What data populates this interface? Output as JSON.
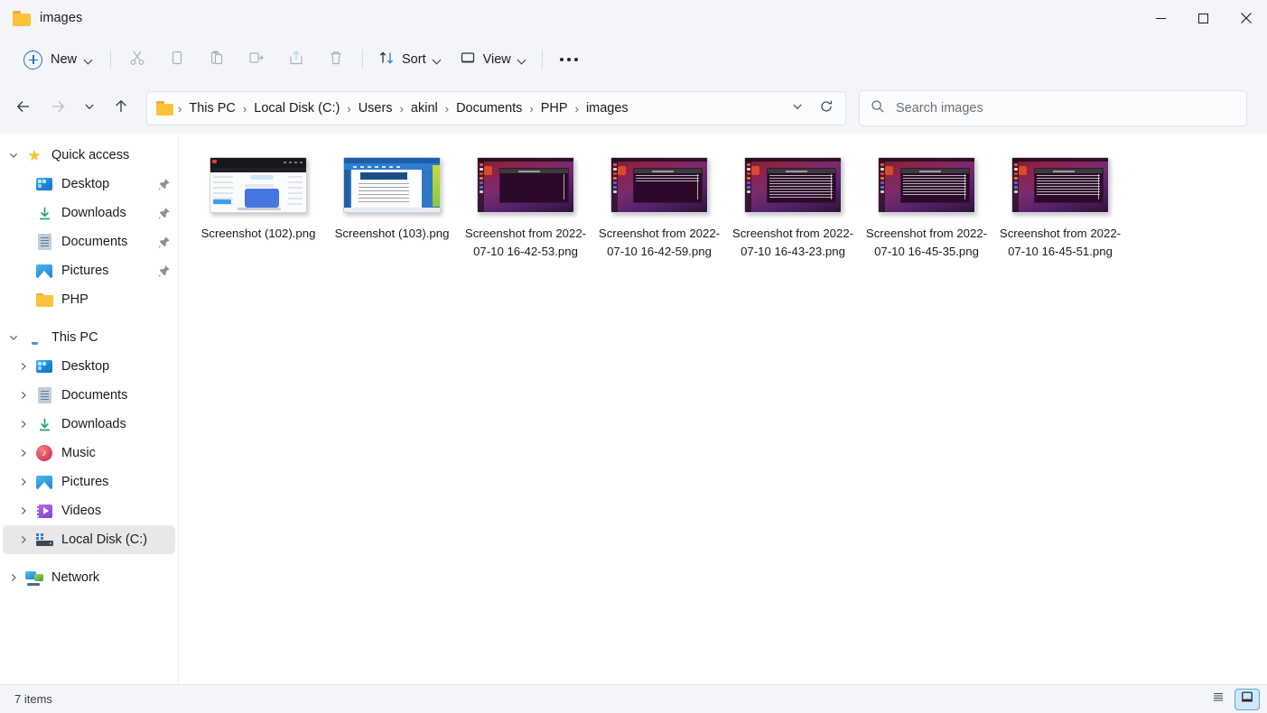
{
  "window": {
    "title": "images",
    "folder_icon": "folder-icon",
    "controls": {
      "minimize": "minimize-icon",
      "maximize": "maximize-icon",
      "close": "close-icon"
    }
  },
  "toolbar": {
    "new_label": "New",
    "sort_label": "Sort",
    "view_label": "View",
    "icons": {
      "cut": "cut-icon",
      "copy": "copy-icon",
      "paste": "paste-icon",
      "rename": "rename-icon",
      "share": "share-icon",
      "delete": "delete-icon",
      "more": "see-more-icon"
    }
  },
  "navigation": {
    "back": "back-arrow-icon",
    "forward": "forward-arrow-icon",
    "recent": "recent-locations-icon",
    "up": "up-arrow-icon",
    "refresh": "refresh-icon",
    "history_dropdown": "previous-locations-icon"
  },
  "breadcrumb": [
    "This PC",
    "Local Disk (C:)",
    "Users",
    "akinl",
    "Documents",
    "PHP",
    "images"
  ],
  "search": {
    "placeholder": "Search images",
    "value": "",
    "icon": "search-icon"
  },
  "sidebar": {
    "quick_access": {
      "label": "Quick access",
      "icon": "star-icon",
      "expanded": true,
      "items": [
        {
          "label": "Desktop",
          "icon": "desktop-icon",
          "pinned": true
        },
        {
          "label": "Downloads",
          "icon": "download-icon",
          "pinned": true
        },
        {
          "label": "Documents",
          "icon": "documents-icon",
          "pinned": true
        },
        {
          "label": "Pictures",
          "icon": "pictures-icon",
          "pinned": true
        },
        {
          "label": "PHP",
          "icon": "folder-icon",
          "pinned": false
        }
      ]
    },
    "this_pc": {
      "label": "This PC",
      "icon": "this-pc-icon",
      "expanded": true,
      "items": [
        {
          "label": "Desktop",
          "icon": "desktop-icon",
          "selected": false
        },
        {
          "label": "Documents",
          "icon": "documents-icon",
          "selected": false
        },
        {
          "label": "Downloads",
          "icon": "download-icon",
          "selected": false
        },
        {
          "label": "Music",
          "icon": "music-icon",
          "selected": false
        },
        {
          "label": "Pictures",
          "icon": "pictures-icon",
          "selected": false
        },
        {
          "label": "Videos",
          "icon": "videos-icon",
          "selected": false
        },
        {
          "label": "Local Disk (C:)",
          "icon": "disk-icon",
          "selected": true
        }
      ]
    },
    "network": {
      "label": "Network",
      "icon": "network-icon"
    }
  },
  "files": [
    {
      "name": "Screenshot (102).png",
      "thumb": "app-light"
    },
    {
      "name": "Screenshot (103).png",
      "thumb": "word-doc"
    },
    {
      "name": "Screenshot from 2022-07-10 16-42-53.png",
      "thumb": "ubuntu-terminal-empty"
    },
    {
      "name": "Screenshot from 2022-07-10 16-42-59.png",
      "thumb": "ubuntu-terminal-few"
    },
    {
      "name": "Screenshot from 2022-07-10 16-43-23.png",
      "thumb": "ubuntu-terminal-list"
    },
    {
      "name": "Screenshot from 2022-07-10 16-45-35.png",
      "thumb": "ubuntu-terminal-log"
    },
    {
      "name": "Screenshot from 2022-07-10 16-45-51.png",
      "thumb": "ubuntu-terminal-list2"
    }
  ],
  "status": {
    "item_count": "7 items",
    "view_details_icon": "details-view-icon",
    "view_large_icons_icon": "large-icons-view-icon",
    "active_view": "large-icons"
  },
  "colors": {
    "chrome": "#f3f5f9",
    "accent": "#2f6fbe",
    "selection": "#e8e8e8",
    "folder_yellow": "#fbc23a"
  }
}
